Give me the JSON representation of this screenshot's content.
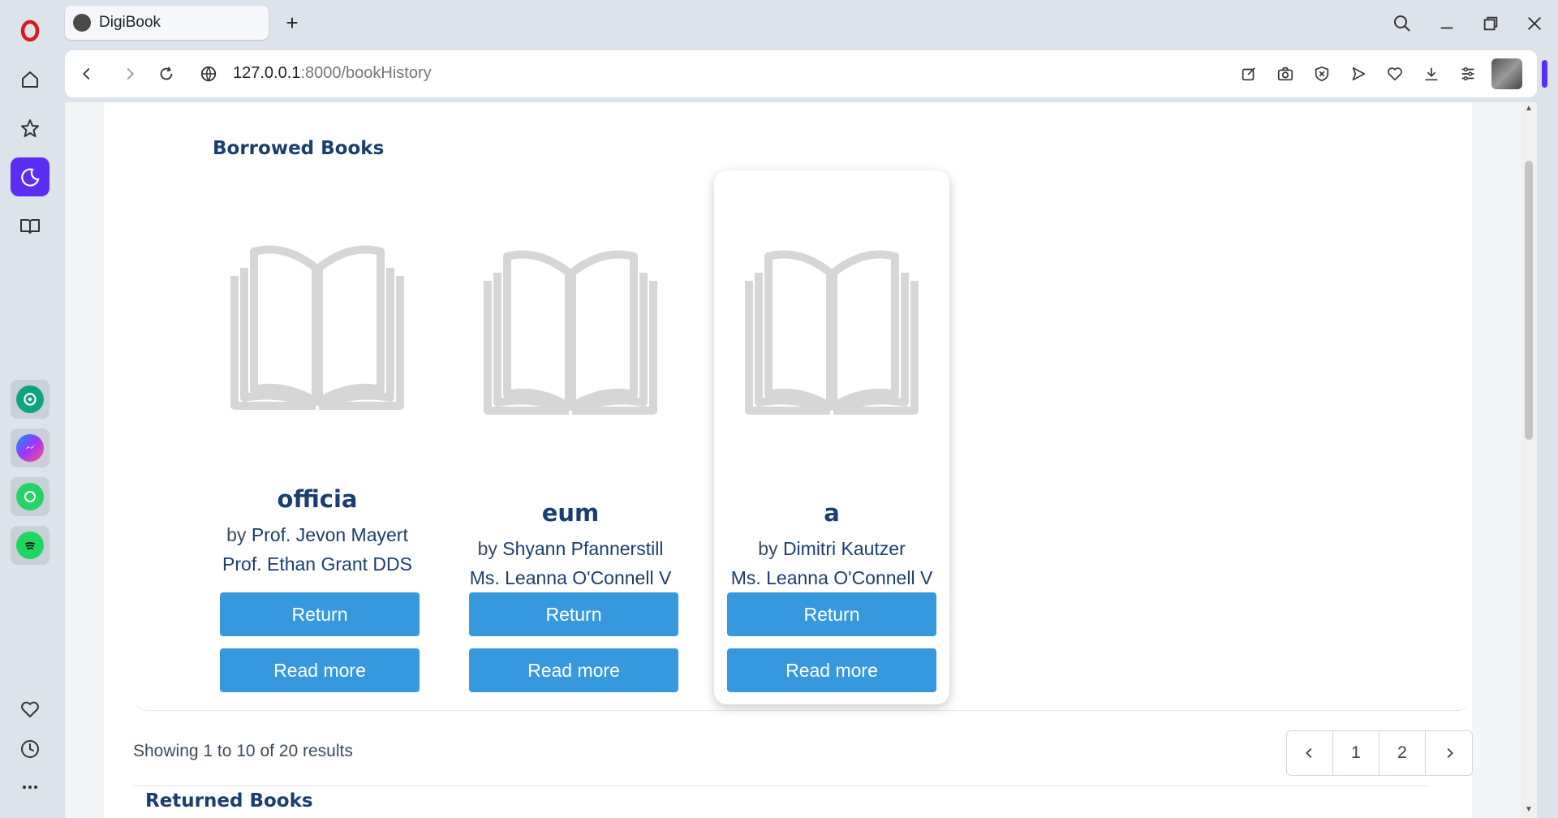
{
  "browser": {
    "tab_title": "DigiBook",
    "new_tab_symbol": "+",
    "url_host": "127.0.0.1",
    "url_path": ":8000/bookHistory"
  },
  "sidebar": {
    "items": [
      "opera-logo",
      "home-icon",
      "star-icon",
      "moon-icon",
      "book-icon"
    ],
    "apps": [
      "chatgpt-icon",
      "messenger-icon",
      "whatsapp-icon",
      "spotify-icon"
    ],
    "bottom": [
      "heart-icon",
      "clock-icon",
      "more-icon"
    ],
    "accent_color": "#5b2ef5"
  },
  "page": {
    "borrowed_title": "Borrowed Books",
    "returned_title": "Returned Books",
    "by_label": "by",
    "return_label": "Return",
    "read_more_label": "Read more",
    "showing_text": "Showing 1 to 10 of 20 results",
    "pages": [
      "1",
      "2"
    ],
    "button_color": "#3699de",
    "title_color": "#1a3e6e"
  },
  "books": [
    {
      "title": "officia",
      "author": "Prof. Jevon Mayert",
      "librarian": "Prof. Ethan Grant DDS"
    },
    {
      "title": "eum",
      "author": "Shyann Pfannerstill",
      "librarian": "Ms. Leanna O'Connell V"
    },
    {
      "title": "a",
      "author": "Dimitri Kautzer",
      "librarian": "Ms. Leanna O'Connell V"
    }
  ]
}
